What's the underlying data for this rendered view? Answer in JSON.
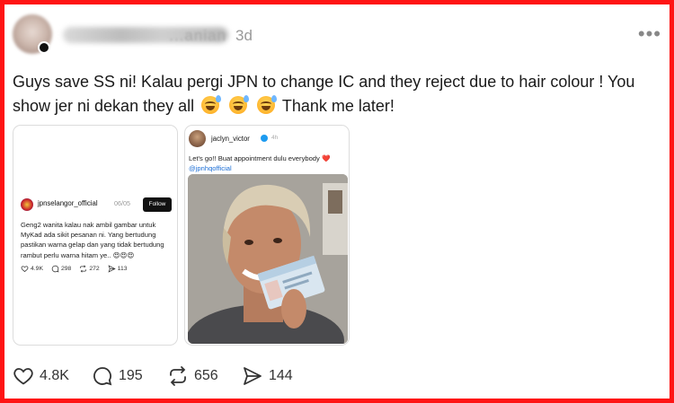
{
  "post": {
    "username_suffix": "...anian",
    "time": "3d",
    "text_part1": "Guys save SS ni! Kalau pergi JPN to change IC and they reject due to hair colour ! You show jer ni dekan they all",
    "text_part2": "Thank me later!"
  },
  "card_a": {
    "handle": "jpnselangor_official",
    "date": "06/05",
    "follow_label": "Follow",
    "text": "Geng2 wanita kalau nak ambil gambar untuk MyKad ada sikit pesanan ni. Yang bertudung pastikan warna gelap dan yang tidak bertudung rambut perlu warna hitam ye..",
    "text_emojis": "😍😍😍",
    "stats": {
      "likes": "4.9K",
      "replies": "298",
      "reposts": "272",
      "shares": "113"
    }
  },
  "card_b": {
    "handle": "jaclyn_victor",
    "date": "4h",
    "text": "Let's go!! Buat appointment dulu everybody",
    "heart": "❤️",
    "mention": "@jpnhqofficial"
  },
  "actions": {
    "likes": "4.8K",
    "replies": "195",
    "reposts": "656",
    "shares": "144"
  },
  "colors": {
    "frame": "#ff1414",
    "verified": "#1d9bf0",
    "mention": "#1d6fd6"
  },
  "icons": [
    "more-icon",
    "heart-icon",
    "reply-icon",
    "repost-icon",
    "share-icon",
    "verified-icon"
  ]
}
